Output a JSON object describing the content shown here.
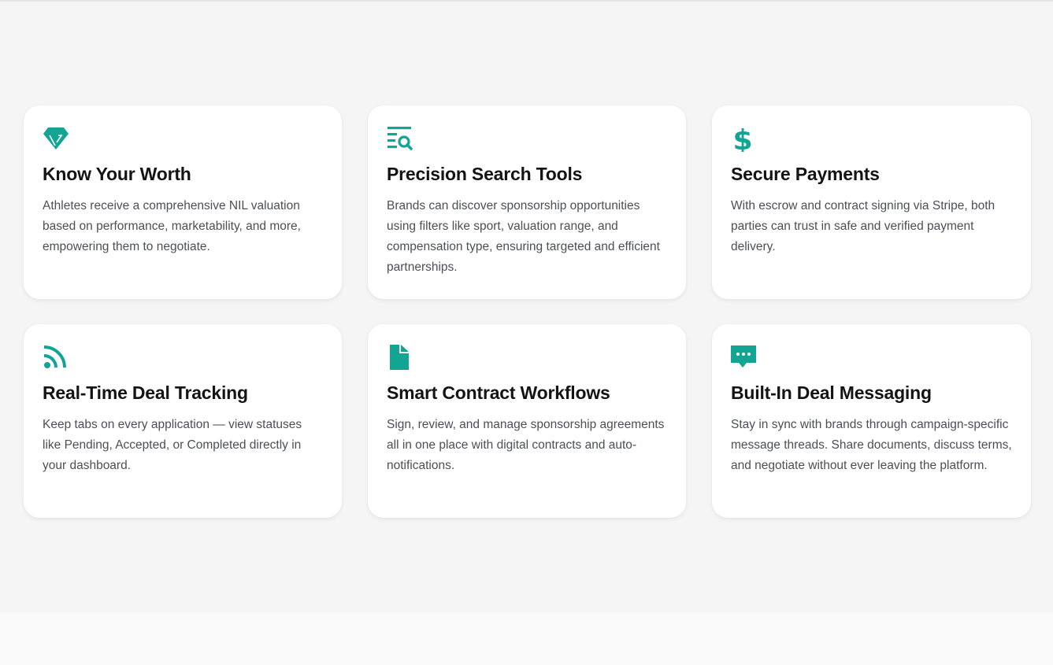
{
  "theme": {
    "accent": "#12a594",
    "card_background": "#ffffff",
    "section_background": "#f5f5f5"
  },
  "features": [
    {
      "icon": "diamond-icon",
      "title": "Know Your Worth",
      "description": "Athletes receive a comprehensive NIL valuation based on performance, marketability, and more, empowering them to negotiate."
    },
    {
      "icon": "search-list-icon",
      "title": "Precision Search Tools",
      "description": "Brands can discover sponsorship opportunities using filters like sport, valuation range, and compensation type, ensuring targeted and efficient partnerships."
    },
    {
      "icon": "dollar-icon",
      "title": "Secure Payments",
      "description": "With escrow and contract signing via Stripe, both parties can trust in safe and verified payment delivery."
    },
    {
      "icon": "rss-icon",
      "title": "Real-Time Deal Tracking",
      "description": "Keep tabs on every application — view statuses like Pending, Accepted, or Completed directly in your dashboard."
    },
    {
      "icon": "document-icon",
      "title": "Smart Contract Workflows",
      "description": "Sign, review, and manage sponsorship agreements all in one place with digital contracts and auto-notifications."
    },
    {
      "icon": "message-icon",
      "title": "Built-In Deal Messaging",
      "description": "Stay in sync with brands through campaign-specific message threads. Share documents, discuss terms, and negotiate without ever leaving the platform."
    }
  ]
}
